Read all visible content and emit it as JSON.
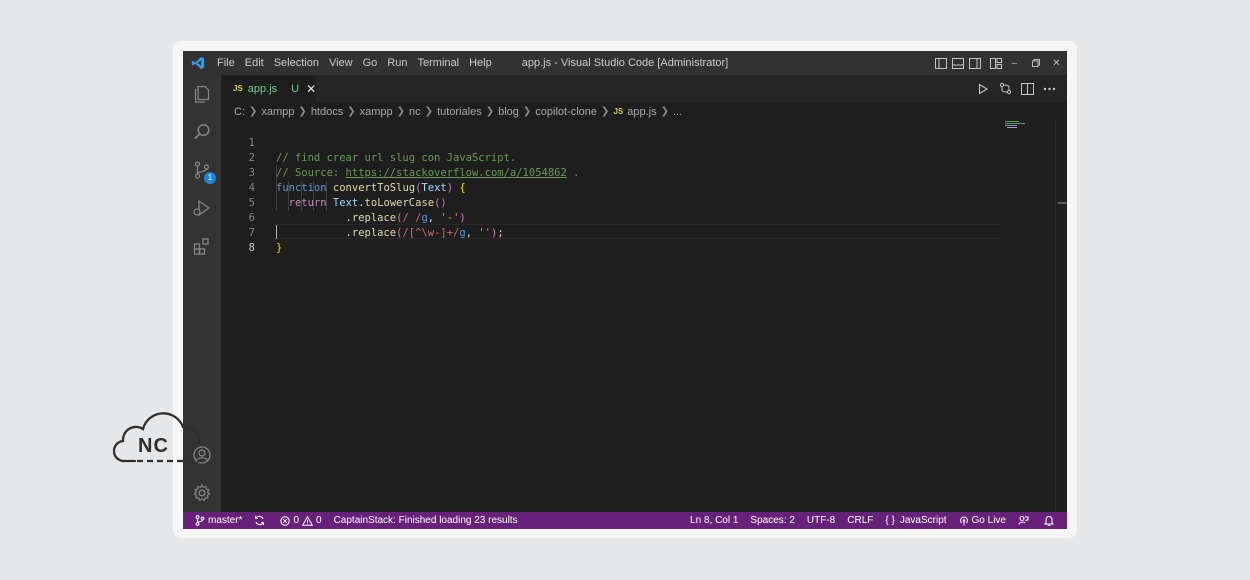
{
  "window": {
    "title": "app.js - Visual Studio Code [Administrator]",
    "menu": [
      "File",
      "Edit",
      "Selection",
      "View",
      "Go",
      "Run",
      "Terminal",
      "Help"
    ]
  },
  "activity_bar": {
    "items": [
      "explorer-icon",
      "search-icon",
      "source-control-icon",
      "run-debug-icon",
      "extensions-icon",
      "account-icon",
      "manage-gear-icon"
    ],
    "source_control_badge": "1"
  },
  "tab": {
    "icon": "JS",
    "name": "app.js",
    "status": "U",
    "close": "✕"
  },
  "breadcrumb": {
    "parts": [
      "C:",
      "xampp",
      "htdocs",
      "xampp",
      "nc",
      "tutoriales",
      "blog",
      "copilot-clone"
    ],
    "file_icon": "JS",
    "file": "app.js",
    "tail": "..."
  },
  "editor": {
    "line_numbers": [
      "1",
      "2",
      "3",
      "4",
      "5",
      "6",
      "7",
      "8"
    ],
    "active_line": "8",
    "code": {
      "l1": "// find crear url slug con JavaScript.",
      "l2_prefix": "// Source: ",
      "l2_link": "https://stackoverflow.com/a/1054862",
      "l2_suffix": " .",
      "l3_kw": "function",
      "l3_fn": "convertToSlug",
      "l3_open": "(",
      "l3_param": "Text",
      "l3_close": ")",
      "l3_brace": "{",
      "l4_kw": "return",
      "l4_var": "Text",
      "l4_dot": ".",
      "l4_fn": "toLowerCase",
      "l4_paren": "()",
      "l5_dot": ".",
      "l5_fn": "replace",
      "l5_open": "(",
      "l5_re": "/ /",
      "l5_flag": "g",
      "l5_comma": ", ",
      "l5_str": "'-'",
      "l5_close": ")",
      "l6_dot": ".",
      "l6_fn": "replace",
      "l6_open": "(",
      "l6_re": "/[^\\w-]+/",
      "l6_flag": "g",
      "l6_comma": ", ",
      "l6_str": "''",
      "l6_close": ")",
      "l6_semi": ";",
      "l7": "}"
    }
  },
  "status_bar": {
    "branch": "master*",
    "errors": "0",
    "warnings": "0",
    "message": "CaptainStack: Finished loading 23 results",
    "position": "Ln 8, Col 1",
    "spaces": "Spaces: 2",
    "encoding": "UTF-8",
    "eol": "CRLF",
    "language_icon": "{ }",
    "language": "JavaScript",
    "go_live": "Go Live",
    "colors": {
      "background": "#68217a"
    }
  },
  "watermark": {
    "logo_text": "NC"
  }
}
